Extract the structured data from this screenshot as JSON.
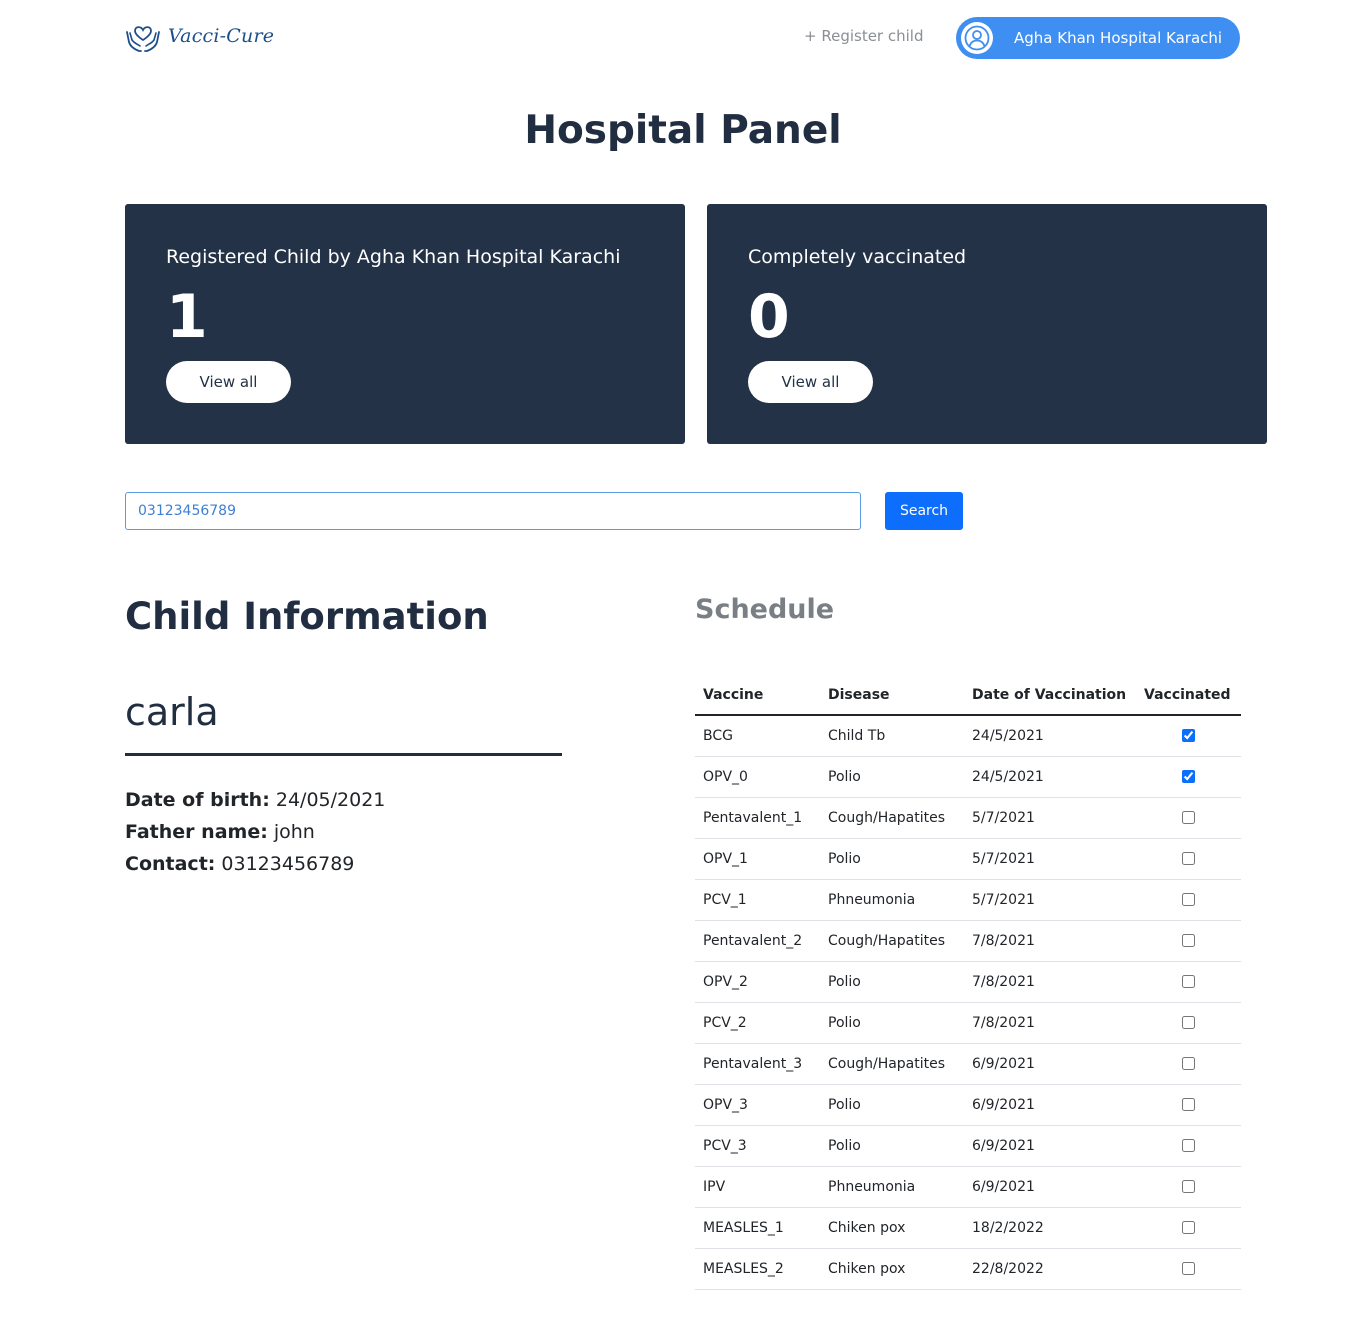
{
  "nav": {
    "brand": "Vacci-Cure",
    "register_link": "+ Register child",
    "hospital_button": "Agha Khan Hospital Karachi"
  },
  "page_title": "Hospital Panel",
  "cards": [
    {
      "label": "Registered Child by Agha Khan Hospital Karachi",
      "count": "1",
      "button": "View all"
    },
    {
      "label": "Completely vaccinated",
      "count": "0",
      "button": "View all"
    }
  ],
  "search": {
    "value": "03123456789",
    "button": "Search"
  },
  "child": {
    "heading": "Child Information",
    "name": "carla",
    "dob_label": "Date of birth:",
    "dob": "24/05/2021",
    "father_label": "Father name:",
    "father": "john",
    "contact_label": "Contact:",
    "contact": "03123456789"
  },
  "schedule": {
    "heading": "Schedule",
    "columns": [
      "Vaccine",
      "Disease",
      "Date of Vaccination",
      "Vaccinated"
    ],
    "rows": [
      {
        "vaccine": "BCG",
        "disease": "Child Tb",
        "date": "24/5/2021",
        "vaccinated": true
      },
      {
        "vaccine": "OPV_0",
        "disease": "Polio",
        "date": "24/5/2021",
        "vaccinated": true
      },
      {
        "vaccine": "Pentavalent_1",
        "disease": "Cough/Hapatites",
        "date": "5/7/2021",
        "vaccinated": false
      },
      {
        "vaccine": "OPV_1",
        "disease": "Polio",
        "date": "5/7/2021",
        "vaccinated": false
      },
      {
        "vaccine": "PCV_1",
        "disease": "Phneumonia",
        "date": "5/7/2021",
        "vaccinated": false
      },
      {
        "vaccine": "Pentavalent_2",
        "disease": "Cough/Hapatites",
        "date": "7/8/2021",
        "vaccinated": false
      },
      {
        "vaccine": "OPV_2",
        "disease": "Polio",
        "date": "7/8/2021",
        "vaccinated": false
      },
      {
        "vaccine": "PCV_2",
        "disease": "Polio",
        "date": "7/8/2021",
        "vaccinated": false
      },
      {
        "vaccine": "Pentavalent_3",
        "disease": "Cough/Hapatites",
        "date": "6/9/2021",
        "vaccinated": false
      },
      {
        "vaccine": "OPV_3",
        "disease": "Polio",
        "date": "6/9/2021",
        "vaccinated": false
      },
      {
        "vaccine": "PCV_3",
        "disease": "Polio",
        "date": "6/9/2021",
        "vaccinated": false
      },
      {
        "vaccine": "IPV",
        "disease": "Phneumonia",
        "date": "6/9/2021",
        "vaccinated": false
      },
      {
        "vaccine": "MEASLES_1",
        "disease": "Chiken pox",
        "date": "18/2/2022",
        "vaccinated": false
      },
      {
        "vaccine": "MEASLES_2",
        "disease": "Chiken pox",
        "date": "22/8/2022",
        "vaccinated": false
      }
    ]
  },
  "colors": {
    "card_bg": "#233246",
    "primary": "#0d6efd",
    "nav_pill": "#3f8ff2",
    "brand": "#1c4f8c"
  },
  "icons": {
    "logo": "heart-hands-icon",
    "avatar": "user-circle-icon"
  }
}
